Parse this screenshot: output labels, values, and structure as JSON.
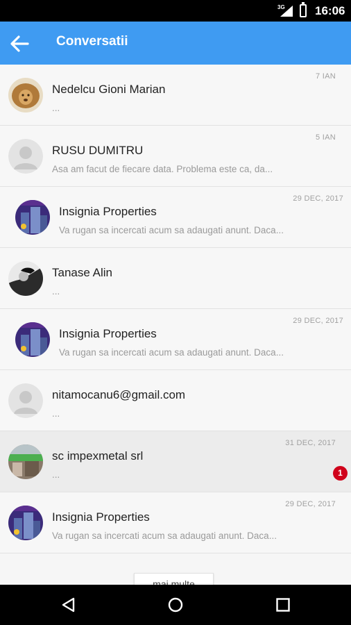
{
  "status_bar": {
    "network": "3G",
    "time": "16:06"
  },
  "app_bar": {
    "title": "Conversatii",
    "back_icon": "arrow-left-icon"
  },
  "conversations": [
    {
      "name": "Nedelcu Gioni Marian",
      "preview": "...",
      "date": "7 IAN",
      "avatar": "lion-photo",
      "indent": false,
      "highlight": false
    },
    {
      "name": "RUSU DUMITRU",
      "preview": "Asa am facut de fiecare data. Problema este ca, da...",
      "date": "5 IAN",
      "avatar": "default-user",
      "indent": false,
      "highlight": false
    },
    {
      "name": "Insignia Properties",
      "preview": "Va rugan sa incercati acum sa adaugati anunt. Daca...",
      "date": "29 DEC, 2017",
      "avatar": "insignia-logo",
      "indent": true,
      "highlight": false
    },
    {
      "name": "Tanase Alin",
      "preview": "...",
      "date": "",
      "avatar": "bw-photo",
      "indent": false,
      "highlight": false
    },
    {
      "name": "Insignia Properties",
      "preview": "Va rugan sa incercati acum sa adaugati anunt. Daca...",
      "date": "29 DEC, 2017",
      "avatar": "insignia-logo",
      "indent": true,
      "highlight": false
    },
    {
      "name": "nitamocanu6@gmail.com",
      "preview": "...",
      "date": "",
      "avatar": "default-user",
      "indent": false,
      "highlight": false
    },
    {
      "name": "sc impexmetal srl",
      "preview": "...",
      "date": "31 DEC, 2017",
      "avatar": "company-photo",
      "indent": false,
      "highlight": true,
      "unread": "1"
    },
    {
      "name": "Insignia Properties",
      "preview": "Va rugan sa incercati acum sa adaugati anunt. Daca...",
      "date": "29 DEC, 2017",
      "avatar": "insignia-logo",
      "indent": false,
      "highlight": false
    }
  ],
  "more_button": "mai multe",
  "nav_bar": {
    "back": "nav-back-icon",
    "home": "nav-home-icon",
    "recents": "nav-recents-icon"
  },
  "colors": {
    "app_bar": "#3f9bf2",
    "badge": "#d0021b"
  }
}
